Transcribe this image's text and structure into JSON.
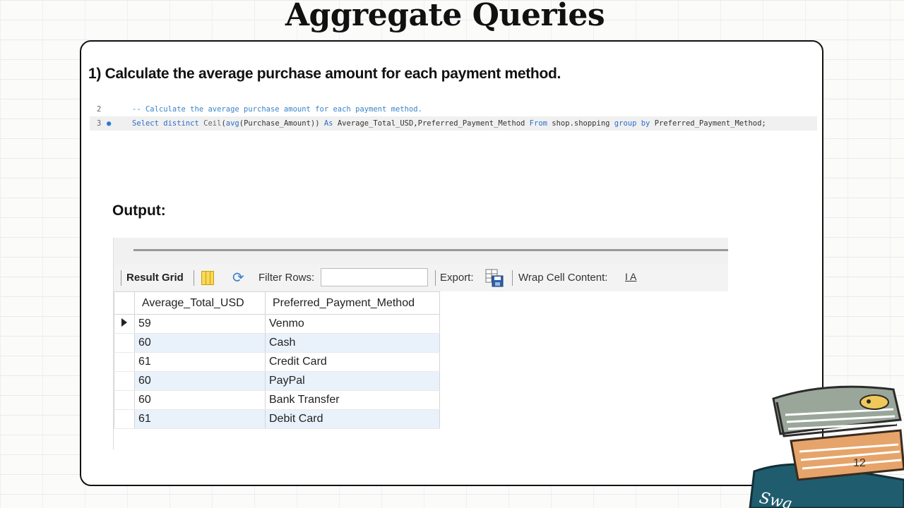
{
  "slide": {
    "title": "Aggregate Queries",
    "question": "1) Calculate the average purchase amount for each payment method.",
    "output_label": "Output:",
    "page_number": "12"
  },
  "editor": {
    "lines": [
      {
        "number": "2",
        "comment": "-- Calculate the average purchase amount for each payment method."
      },
      {
        "number": "3",
        "parts": {
          "k1": "Select distinct",
          "f1": "Ceil",
          "t1": "(",
          "k2": "avg",
          "t2": "(Purchase_Amount)) ",
          "k3": "As",
          "t3": " Average_Total_USD,Preferred_Payment_Method ",
          "k4": "From",
          "t4": " shop.shopping ",
          "k5": "group by",
          "t5": " Preferred_Payment_Method;"
        }
      }
    ]
  },
  "toolbar": {
    "result_grid": "Result Grid",
    "filter_rows": "Filter Rows:",
    "filter_value": "",
    "export": "Export:",
    "wrap": "Wrap Cell Content:",
    "wrap_icon": "̲I̲A"
  },
  "table": {
    "columns": [
      "Average_Total_USD",
      "Preferred_Payment_Method"
    ],
    "rows": [
      [
        "59",
        "Venmo"
      ],
      [
        "60",
        "Cash"
      ],
      [
        "61",
        "Credit Card"
      ],
      [
        "60",
        "PayPal"
      ],
      [
        "60",
        "Bank Transfer"
      ],
      [
        "61",
        "Debit Card"
      ]
    ]
  },
  "icons": {
    "grid": "result-grid-icon",
    "refresh": "refresh-icon",
    "export": "export-icon",
    "wrap": "wrap-cell-icon"
  },
  "decoration": {
    "books_text": "Swa"
  }
}
